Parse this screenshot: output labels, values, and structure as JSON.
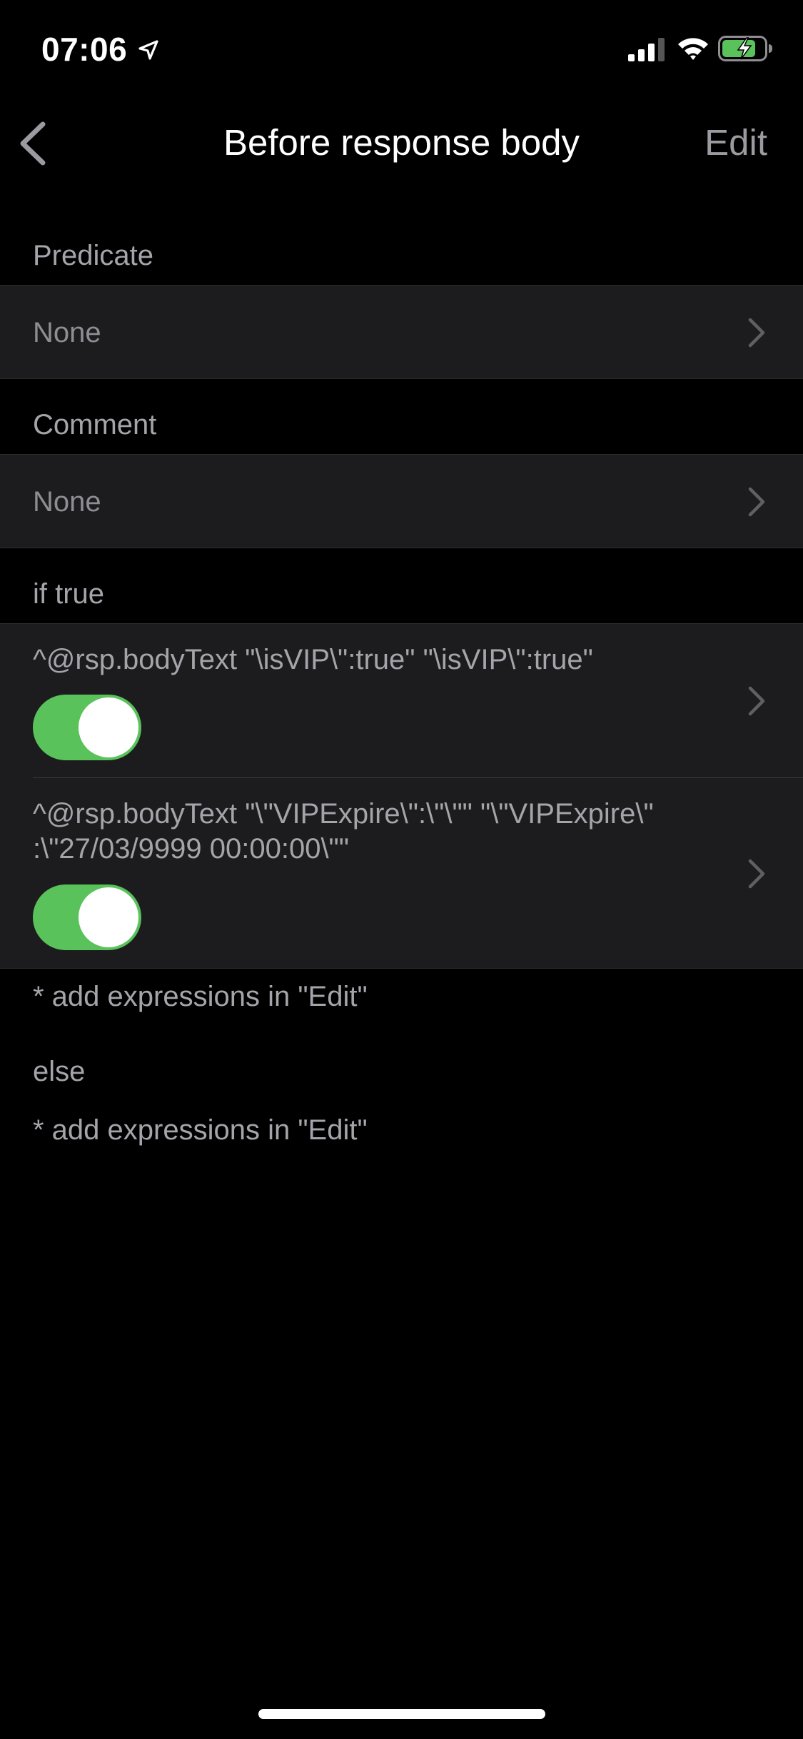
{
  "status_bar": {
    "time": "07:06",
    "icons": [
      "location-arrow-icon",
      "cellular-signal-icon",
      "wifi-icon",
      "battery-charging-icon"
    ],
    "battery_color": "#5ac25a"
  },
  "nav": {
    "title": "Before response body",
    "edit_label": "Edit",
    "back_icon": "chevron-left-icon"
  },
  "predicate": {
    "header": "Predicate",
    "value": "None"
  },
  "comment": {
    "header": "Comment",
    "value": "None"
  },
  "if_true": {
    "header": "if true",
    "expressions": [
      {
        "text": "^@rsp.bodyText \"\\isVIP\\\":true\" \"\\isVIP\\\":true\"",
        "enabled": true
      },
      {
        "text": "^@rsp.bodyText \"\\\"VIPExpire\\\":\\\"\\\"\" \"\\\"VIPExpire\\\"\n:\\\"27/03/9999 00:00:00\\\"\"",
        "enabled": true
      }
    ],
    "hint": "* add expressions in \"Edit\""
  },
  "else": {
    "header": "else",
    "hint": "* add expressions in \"Edit\""
  },
  "colors": {
    "background": "#000000",
    "cell": "#1c1c1e",
    "toggle_on": "#5ac25a",
    "secondary_text": "#a4a4aa"
  }
}
